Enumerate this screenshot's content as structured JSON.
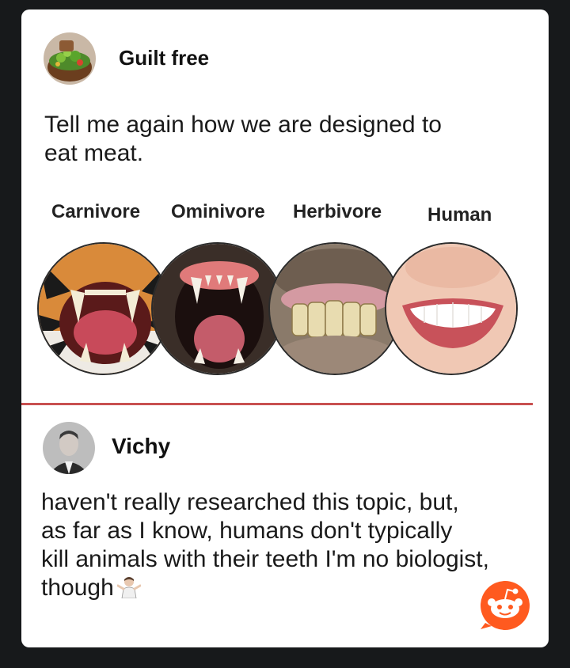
{
  "post": {
    "author": "Guilt free",
    "text_line1": "Tell me again how we are designed to",
    "text_line2": "eat meat."
  },
  "meme": {
    "labels": [
      "Carnivore",
      "Ominivore",
      "Herbivore",
      "Human"
    ],
    "images": [
      "tiger-teeth",
      "dog-teeth",
      "horse-teeth",
      "human-smile"
    ]
  },
  "reply": {
    "author": "Vichy",
    "text_line1": "haven't really researched this topic, but,",
    "text_line2": "as far as I know, humans don't typically",
    "text_line3": "kill animals with their teeth I'm no biologist,",
    "text_line4": "though",
    "emoji": "person-shrugging"
  },
  "watermark": {
    "icon": "reddit-icon",
    "color": "#ff5a1f"
  },
  "colors": {
    "background": "#17191b",
    "card": "#ffffff",
    "divider": "#c85050"
  }
}
